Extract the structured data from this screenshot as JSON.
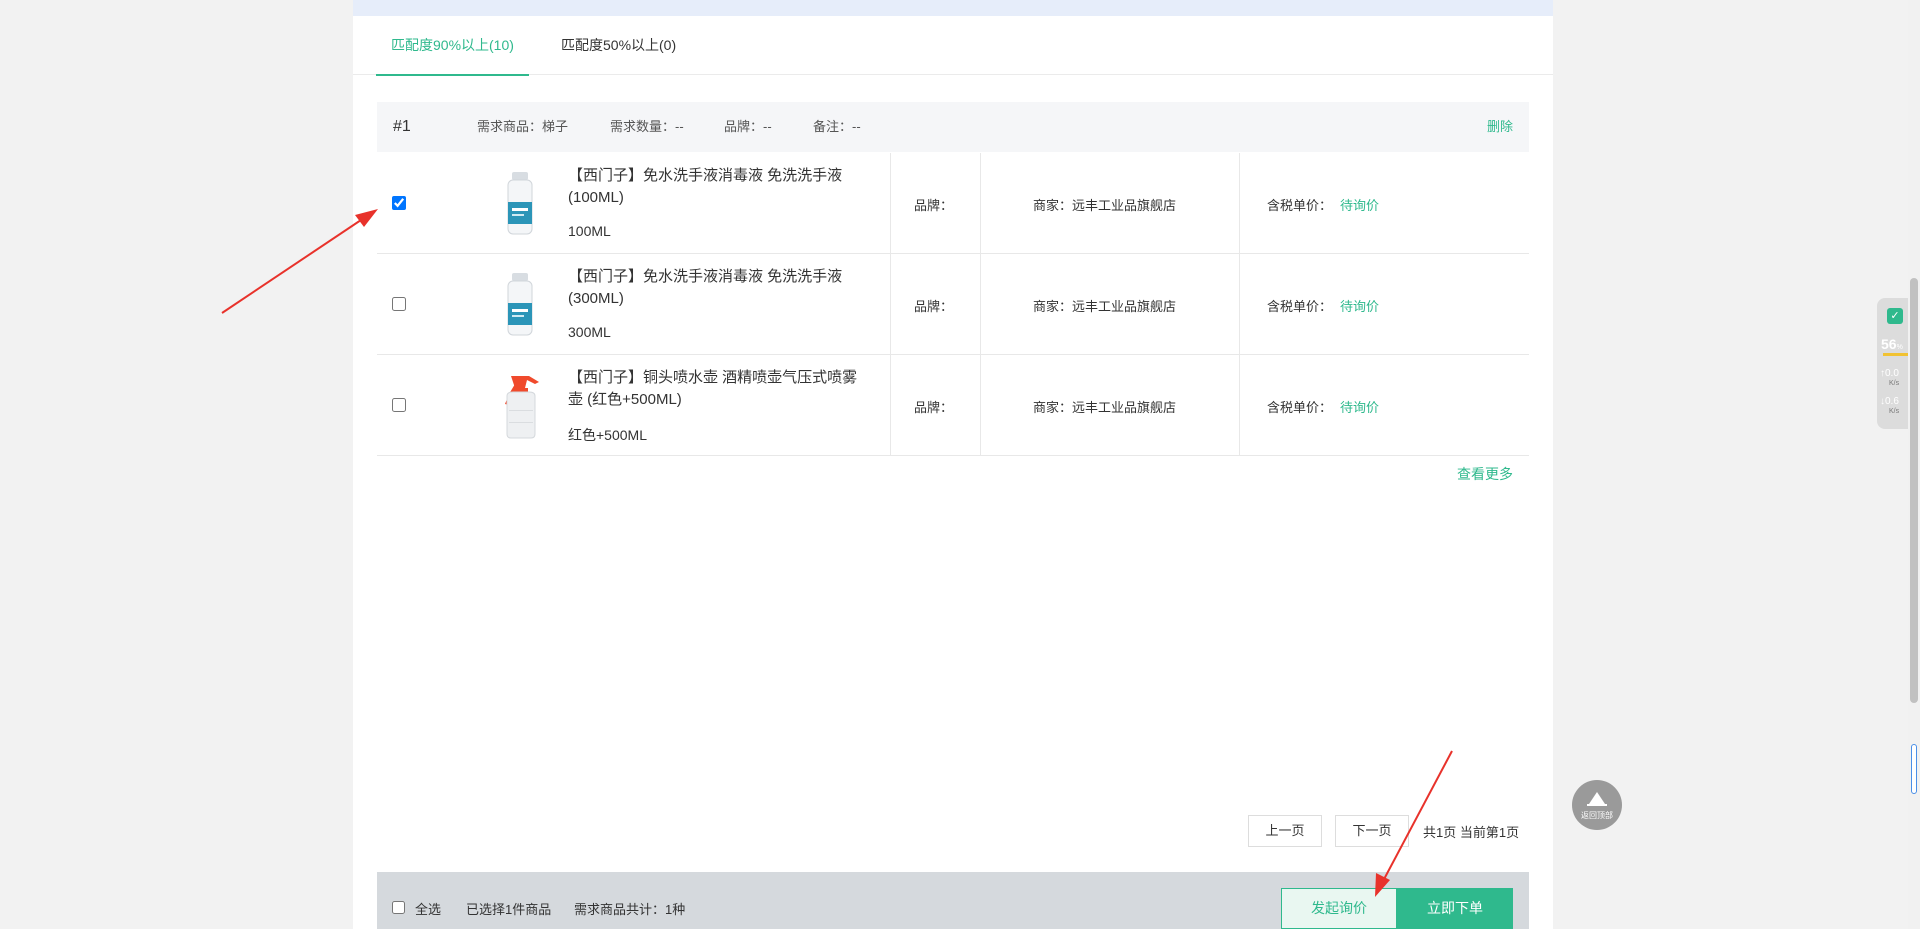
{
  "tabs": [
    {
      "label": "匹配度90%以上(10)",
      "active": true
    },
    {
      "label": "匹配度50%以上(0)",
      "active": false
    }
  ],
  "group": {
    "number": "#1",
    "demand_product": "需求商品：梯子",
    "demand_qty": "需求数量：--",
    "brand": "品牌：--",
    "note": "备注：--",
    "delete_label": "删除"
  },
  "products": [
    {
      "checked": true,
      "image": "spray-bottle-white-blue",
      "title": "【西门子】免水洗手液消毒液 免洗洗手液(100ML)",
      "spec": "100ML",
      "brand_label": "品牌：",
      "merchant": "商家：远丰工业品旗舰店",
      "price_label": "含税单价：",
      "price": "待询价"
    },
    {
      "checked": false,
      "image": "spray-bottle-white-blue",
      "title": "【西门子】免水洗手液消毒液 免洗洗手液(300ML)",
      "spec": "300ML",
      "brand_label": "品牌：",
      "merchant": "商家：远丰工业品旗舰店",
      "price_label": "含税单价：",
      "price": "待询价"
    },
    {
      "checked": false,
      "image": "pressure-sprayer-red",
      "title": "【西门子】铜头喷水壶 酒精喷壶气压式喷雾壶 (红色+500ML)",
      "spec": "红色+500ML",
      "brand_label": "品牌：",
      "merchant": "商家：远丰工业品旗舰店",
      "price_label": "含税单价：",
      "price": "待询价"
    }
  ],
  "see_more": "查看更多",
  "pagination": {
    "prev": "上一页",
    "next": "下一页",
    "info": "共1页 当前第1页"
  },
  "footer": {
    "select_all": "全选",
    "selected": "已选择1件商品",
    "total": "需求商品共计：1种",
    "inquiry_button": "发起询价",
    "order_button": "立即下单"
  },
  "back_to_top": "返回顶部",
  "widget": {
    "percent": "56",
    "percent_unit": "%",
    "upload": "0.0",
    "upload_unit": "K/s",
    "download": "0.6",
    "download_unit": "K/s"
  },
  "colors": {
    "accent": "#2fb98d",
    "annotation_arrow": "#e8322b"
  }
}
